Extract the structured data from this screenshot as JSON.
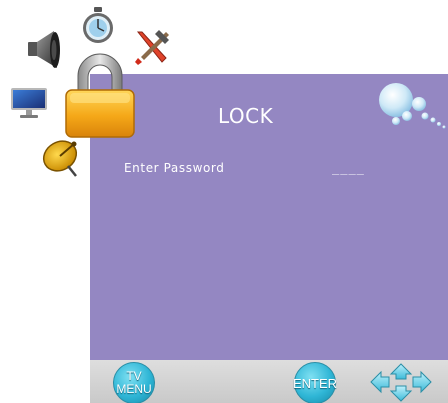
{
  "menu": {
    "title": "LOCK",
    "password_label": "Enter Password",
    "password_mask": "____"
  },
  "footer": {
    "menu_button_line1": "TV",
    "menu_button_line2": "MENU",
    "enter_button": "ENTER"
  },
  "sidebar_icons": [
    "speaker-icon",
    "stopwatch-icon",
    "tools-icon",
    "monitor-icon",
    "lock-icon",
    "satellite-dish-icon"
  ],
  "colors": {
    "panel": "#9487c2",
    "footer": "#d4d4d4",
    "button": "#2fb6d6",
    "lock_body": "#f5a818"
  }
}
